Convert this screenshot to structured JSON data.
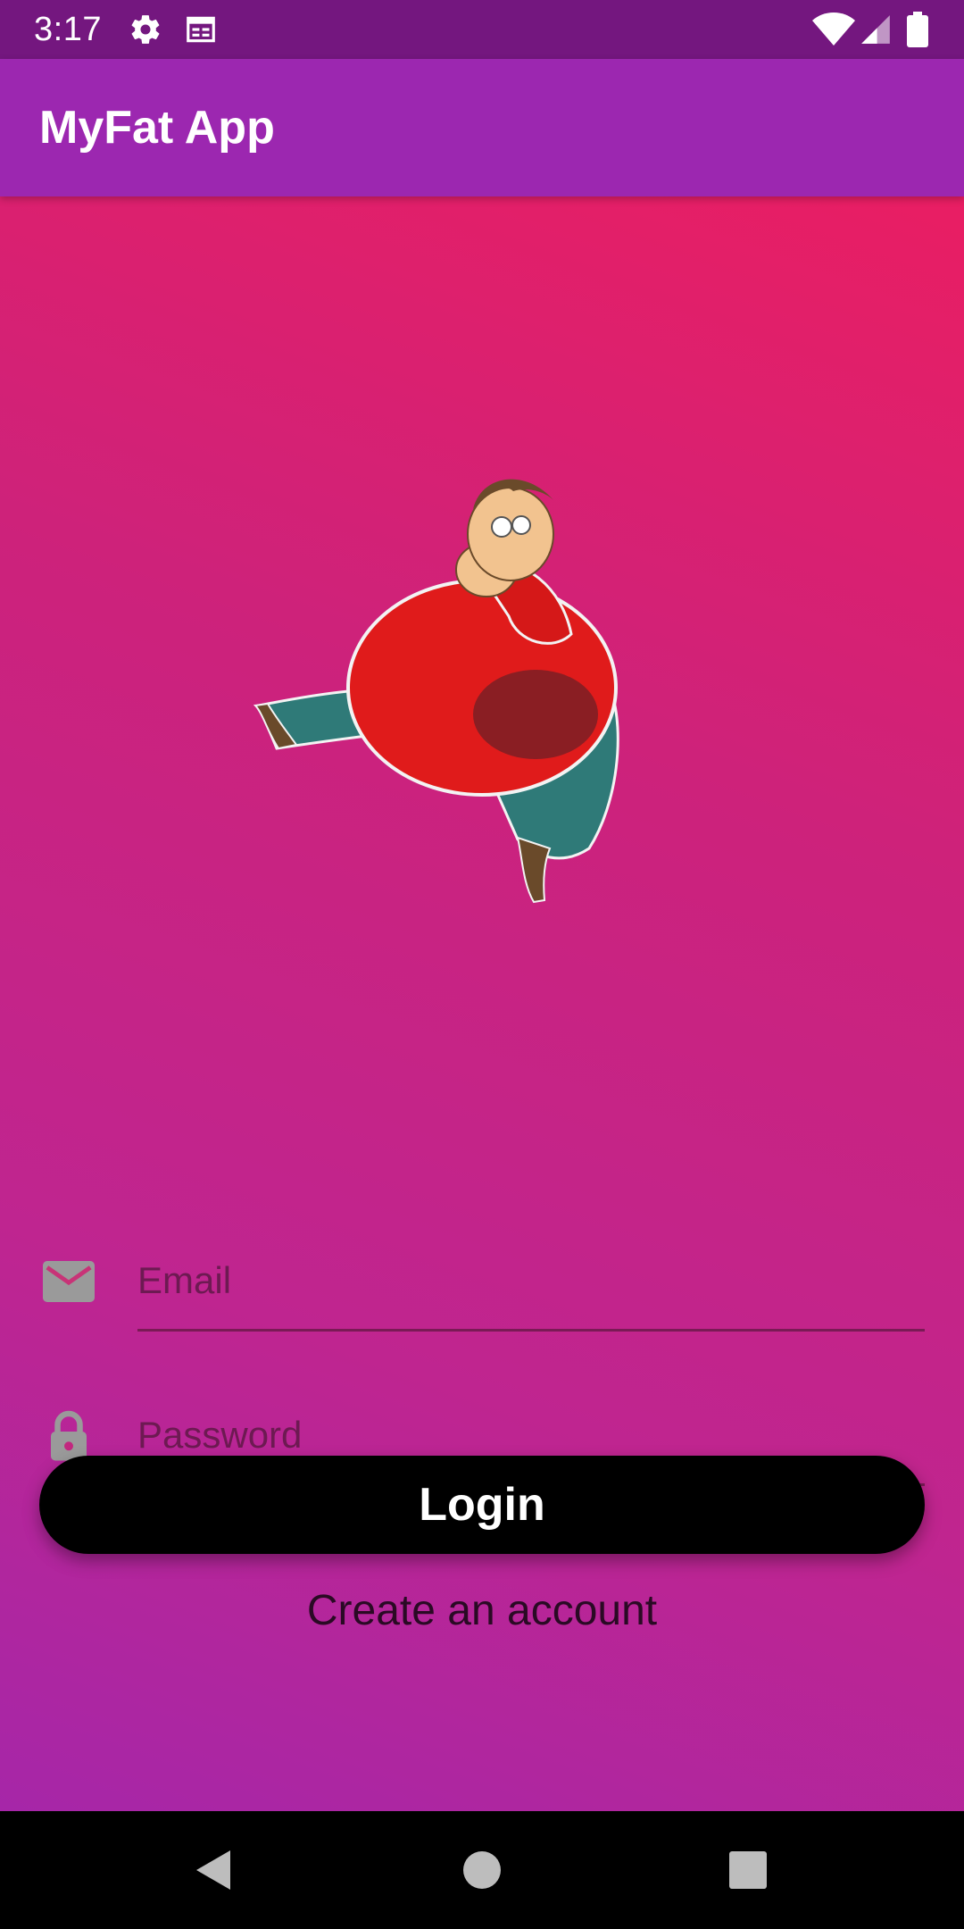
{
  "status_bar": {
    "time": "3:17",
    "icons": [
      "gear-icon",
      "calendar-icon",
      "wifi-icon",
      "signal-icon",
      "battery-icon"
    ]
  },
  "app_bar": {
    "title": "MyFat App"
  },
  "login_form": {
    "email": {
      "icon": "mail-icon",
      "placeholder": "Email",
      "value": ""
    },
    "password": {
      "icon": "lock-icon",
      "placeholder": "Password",
      "value": ""
    },
    "login_label": "Login",
    "create_account_label": "Create an account"
  },
  "nav_bar": {
    "buttons": [
      "back-icon",
      "home-icon",
      "recents-icon"
    ]
  },
  "colors": {
    "status_bar": "#74177f",
    "app_bar": "#9c27b0",
    "gradient_top": "#e91e63",
    "gradient_bottom": "#a626a8",
    "button": "#000000"
  }
}
